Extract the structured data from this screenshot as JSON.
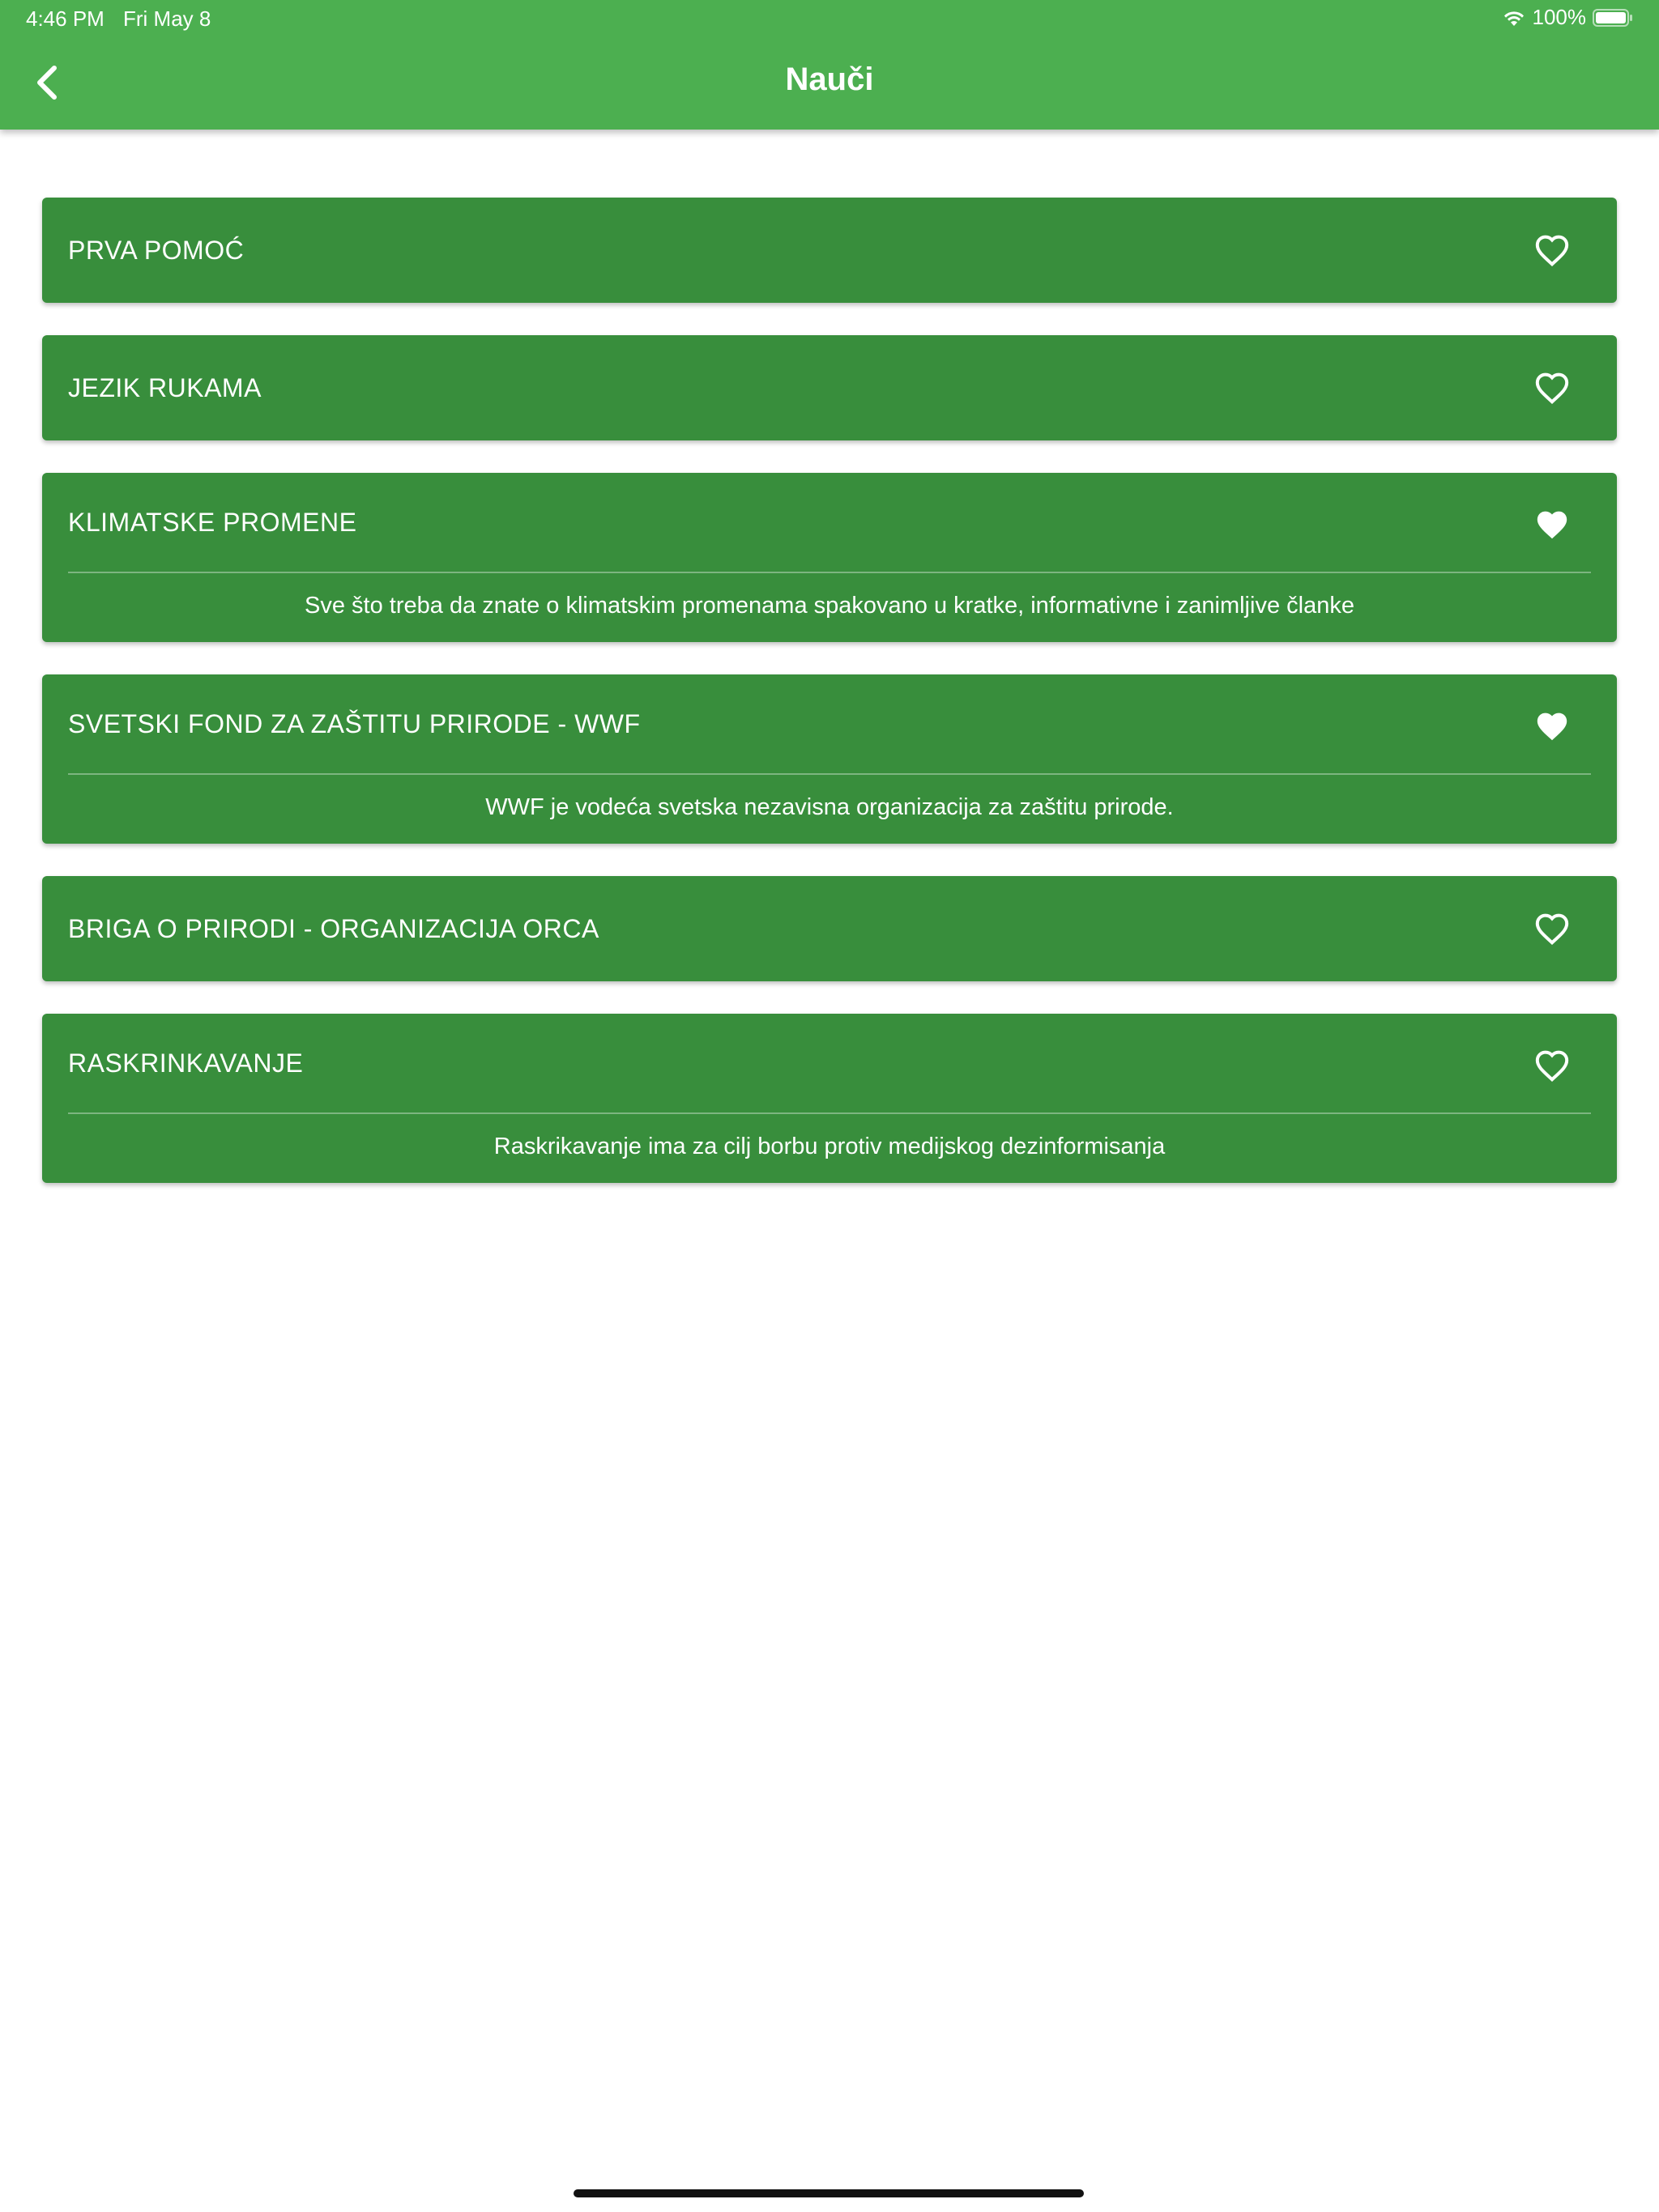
{
  "status_bar": {
    "time": "4:46 PM",
    "date": "Fri May 8",
    "battery": "100%",
    "wifi_icon": "wifi-icon",
    "battery_icon": "battery-icon"
  },
  "header": {
    "title": "Nauči",
    "back_icon": "chevron-left-icon",
    "background": "#4caf50"
  },
  "items": [
    {
      "title": "PRVA POMOĆ",
      "favorite": false,
      "description": ""
    },
    {
      "title": "JEZIK RUKAMA",
      "favorite": false,
      "description": ""
    },
    {
      "title": "KLIMATSKE PROMENE",
      "favorite": true,
      "description": "Sve što treba da znate o klimatskim promenama spakovano u kratke, informativne i zanimljive članke"
    },
    {
      "title": "SVETSKI FOND ZA ZAŠTITU PRIRODE - WWF",
      "favorite": true,
      "description": "WWF je vodeća svetska nezavisna organizacija za zaštitu prirode."
    },
    {
      "title": "BRIGA O PRIRODI - ORGANIZACIJA ORCA",
      "favorite": false,
      "description": ""
    },
    {
      "title": "RASKRINKAVANJE",
      "favorite": false,
      "description": "Raskrikavanje ima za cilj borbu protiv medijskog dezinformisanja"
    }
  ],
  "colors": {
    "card": "#388e3c",
    "app_bar": "#4caf50",
    "text": "#ffffff"
  }
}
